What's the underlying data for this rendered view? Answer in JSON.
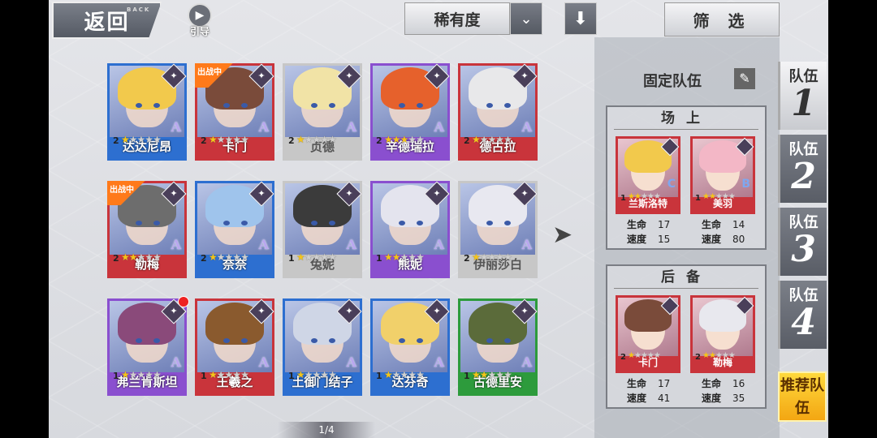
{
  "topbar": {
    "back_label": "返回",
    "back_sub": "BACK",
    "guide_label": "引导",
    "sort_label": "稀有度",
    "filter_label": "筛 选"
  },
  "roster": [
    {
      "name": "达达尼昂",
      "level": "2",
      "stars": 1,
      "color": "blue",
      "deployed": false
    },
    {
      "name": "卡门",
      "level": "2",
      "stars": 1,
      "color": "red",
      "deployed": true
    },
    {
      "name": "贞德",
      "level": "2",
      "stars": 1,
      "color": "white",
      "deployed": false
    },
    {
      "name": "辛德瑞拉",
      "level": "2",
      "stars": 3,
      "color": "purple",
      "deployed": false
    },
    {
      "name": "德古拉",
      "level": "2",
      "stars": 1,
      "color": "red",
      "deployed": false
    },
    {
      "name": "勒梅",
      "level": "2",
      "stars": 2,
      "color": "red",
      "deployed": true
    },
    {
      "name": "奈奈",
      "level": "2",
      "stars": 1,
      "color": "blue",
      "deployed": false
    },
    {
      "name": "兔妮",
      "level": "1",
      "stars": 1,
      "color": "white",
      "deployed": false
    },
    {
      "name": "熊妮",
      "level": "1",
      "stars": 2,
      "color": "purple",
      "deployed": false
    },
    {
      "name": "伊丽莎白",
      "level": "2",
      "stars": 1,
      "color": "white",
      "deployed": false
    },
    {
      "name": "弗兰肯斯坦",
      "level": "1",
      "stars": 1,
      "color": "purple",
      "deployed": false
    },
    {
      "name": "王羲之",
      "level": "1",
      "stars": 1,
      "color": "red",
      "deployed": false
    },
    {
      "name": "土御门结子",
      "level": "1",
      "stars": 1,
      "color": "blue",
      "deployed": false
    },
    {
      "name": "达芬奇",
      "level": "1",
      "stars": 1,
      "color": "blue",
      "deployed": false
    },
    {
      "name": "古德里安",
      "level": "1",
      "stars": 2,
      "color": "green",
      "deployed": false
    }
  ],
  "deploy_tag": "出战中",
  "rank_letter": "A",
  "pagination": "1/4",
  "panel": {
    "fixed_team_label": "固定队伍",
    "onfield_label": "场上",
    "reserve_label": "后备",
    "hp_label": "生命",
    "speed_label": "速度",
    "onfield": [
      {
        "name": "兰斯洛特",
        "level": "1",
        "stars": 2,
        "rank": "C",
        "hp": "17",
        "speed": "15"
      },
      {
        "name": "美羽",
        "level": "1",
        "stars": 2,
        "rank": "B",
        "hp": "14",
        "speed": "80"
      }
    ],
    "reserve": [
      {
        "name": "卡门",
        "level": "2",
        "stars": 1,
        "rank": "",
        "hp": "17",
        "speed": "41"
      },
      {
        "name": "勒梅",
        "level": "2",
        "stars": 2,
        "rank": "",
        "hp": "16",
        "speed": "35"
      }
    ]
  },
  "teams": [
    {
      "label": "队伍",
      "num": "1",
      "active": true
    },
    {
      "label": "队伍",
      "num": "2",
      "active": false
    },
    {
      "label": "队伍",
      "num": "3",
      "active": false
    },
    {
      "label": "队伍",
      "num": "4",
      "active": false
    }
  ],
  "recommend_label": "推荐队伍",
  "colors": {
    "accent_orange": "#ff7a1a",
    "blue": "#2d6fd0",
    "red": "#c9343b",
    "purple": "#8a4fcf",
    "green": "#2d9b3c"
  }
}
